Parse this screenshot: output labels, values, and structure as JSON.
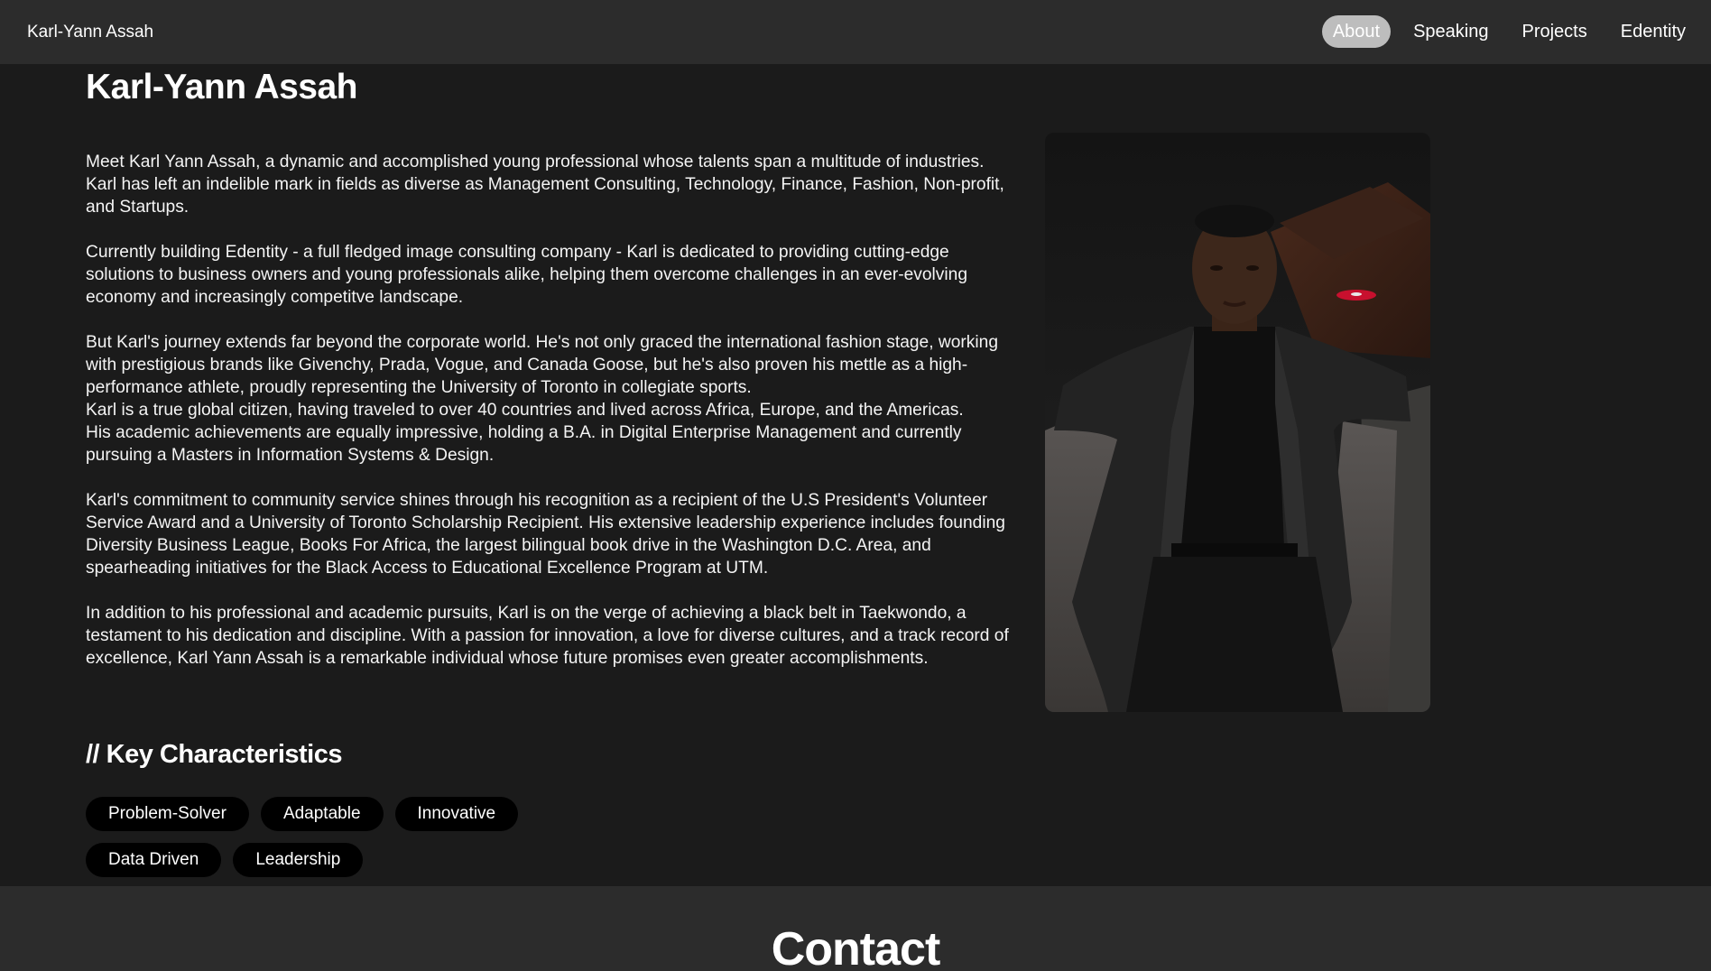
{
  "navbar": {
    "brand": "Karl-Yann Assah",
    "links": [
      {
        "label": "About",
        "active": true
      },
      {
        "label": "Speaking",
        "active": false
      },
      {
        "label": "Projects",
        "active": false
      },
      {
        "label": "Edentity",
        "active": false
      }
    ]
  },
  "about": {
    "title": "Karl-Yann Assah",
    "paragraphs": [
      "Meet Karl Yann Assah, a dynamic and accomplished young professional whose talents span a multitude of industries. Karl has left an indelible mark in fields as diverse as Management Consulting, Technology, Finance, Fashion, Non-profit, and Startups.",
      "Currently building Edentity - a full fledged image consulting company - Karl is dedicated to providing cutting-edge solutions to business owners and young professionals alike, helping them overcome challenges in an ever-evolving economy and increasingly competitve landscape.",
      "But Karl's journey extends far beyond the corporate world. He's not only graced the international fashion stage, working with prestigious brands like Givenchy, Prada, Vogue, and Canada Goose, but he's also proven his mettle as a high-performance athlete, proudly representing the University of Toronto in collegiate sports.",
      "Karl is a true global citizen, having traveled to over 40 countries and lived across Africa, Europe, and the Americas.",
      "His academic achievements are equally impressive, holding a B.A. in Digital Enterprise Management and currently pursuing a Masters in Information Systems & Design.",
      "Karl's commitment to community service shines through his recognition as a recipient of the U.S President's Volunteer Service Award and a University of Toronto Scholarship Recipient. His extensive leadership experience includes founding Diversity Business League, Books For Africa, the largest bilingual book drive in the Washington D.C. Area, and spearheading initiatives for the Black Access to Educational Excellence Program at UTM.",
      "In addition to his professional and academic pursuits, Karl is on the verge of achieving a black belt in Taekwondo, a testament to his dedication and discipline. With a passion for innovation, a love for diverse cultures, and a track record of excellence, Karl Yann Assah is a remarkable individual whose future promises even greater accomplishments."
    ]
  },
  "characteristics": {
    "title": "// Key Characteristics",
    "tags": [
      "Problem-Solver",
      "Adaptable",
      "Innovative",
      "Data Driven",
      "Leadership"
    ]
  },
  "contact": {
    "title": "Contact"
  },
  "colors": {
    "background": "#1b1b1b",
    "navbar": "#2c2c2c",
    "active_pill": "#bdbdbd",
    "tag_background": "#000000",
    "text": "#ffffff"
  }
}
